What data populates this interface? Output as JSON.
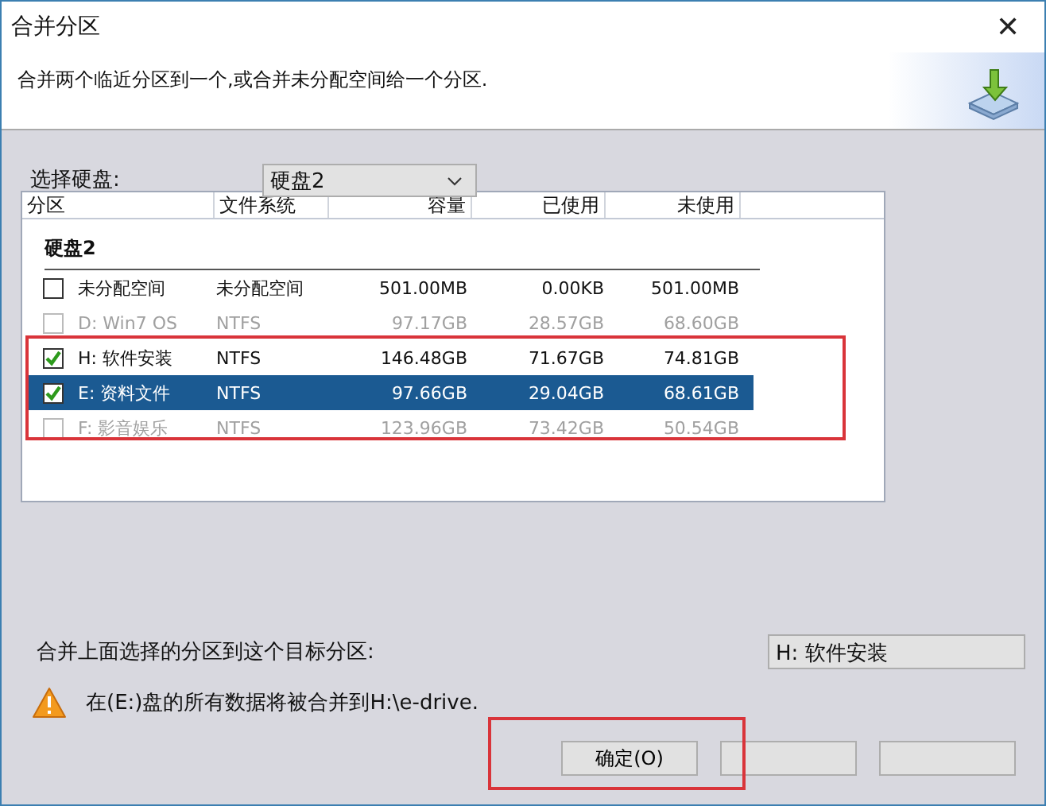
{
  "window": {
    "title": "合并分区",
    "close": "✕"
  },
  "description": "合并两个临近分区到一个,或合并未分配空间给一个分区.",
  "disk_select": {
    "label": "选择硬盘:",
    "value": "硬盘2"
  },
  "table": {
    "columns": [
      "分区",
      "文件系统",
      "容量",
      "已使用",
      "未使用"
    ],
    "group": "硬盘2",
    "rows": [
      {
        "name": "未分配空间",
        "fs": "未分配空间",
        "capacity": "501.00MB",
        "used": "0.00KB",
        "free": "501.00MB",
        "checked": false,
        "disabled": false,
        "selected": false
      },
      {
        "name": "D:  Win7 OS",
        "fs": "NTFS",
        "capacity": "97.17GB",
        "used": "28.57GB",
        "free": "68.60GB",
        "checked": false,
        "disabled": true,
        "selected": false
      },
      {
        "name": "H:  软件安装",
        "fs": "NTFS",
        "capacity": "146.48GB",
        "used": "71.67GB",
        "free": "74.81GB",
        "checked": true,
        "disabled": false,
        "selected": false
      },
      {
        "name": "E:  资料文件",
        "fs": "NTFS",
        "capacity": "97.66GB",
        "used": "29.04GB",
        "free": "68.61GB",
        "checked": true,
        "disabled": false,
        "selected": true
      },
      {
        "name": "F:  影音娱乐",
        "fs": "NTFS",
        "capacity": "123.96GB",
        "used": "73.42GB",
        "free": "50.54GB",
        "checked": false,
        "disabled": true,
        "selected": false
      }
    ]
  },
  "target": {
    "label": "合并上面选择的分区到这个目标分区:",
    "value": "H:  软件安装"
  },
  "warning": "在(E:)盘的所有数据将被合并到H:\\e-drive.",
  "buttons": [
    {
      "kind": "labeled",
      "label": "确定(O)"
    },
    {
      "kind": "covered"
    },
    {
      "kind": "covered"
    }
  ]
}
